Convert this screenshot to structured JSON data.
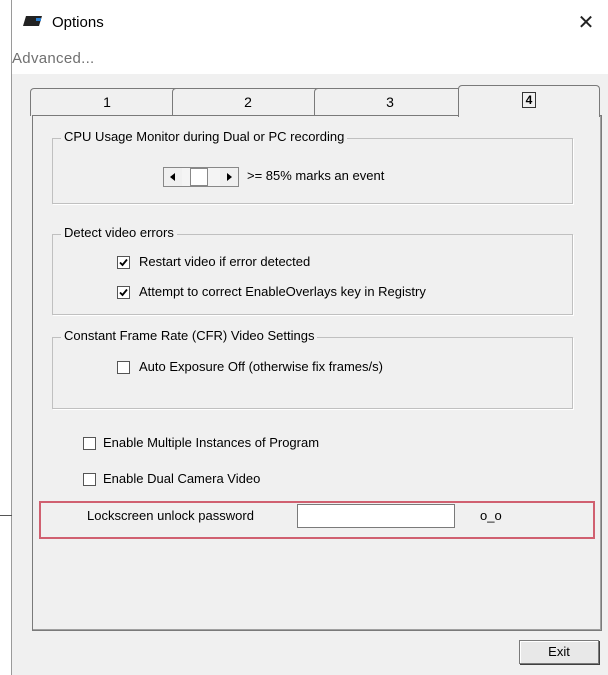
{
  "window": {
    "title": "Options",
    "close_glyph": "✕",
    "app_icon": "camera-icon"
  },
  "menu": {
    "advanced": "Advanced..."
  },
  "tabs": [
    {
      "label": "1",
      "active": false
    },
    {
      "label": "2",
      "active": false
    },
    {
      "label": "3",
      "active": false
    },
    {
      "label": "4",
      "active": true
    }
  ],
  "cpu_group": {
    "title": "CPU Usage Monitor during Dual or PC recording",
    "threshold_text": ">= 85% marks an event"
  },
  "video_errors_group": {
    "title": "Detect video errors",
    "restart_label": "Restart video if error detected",
    "restart_checked": true,
    "overlays_label": "Attempt to correct EnableOverlays key in Registry",
    "overlays_checked": true
  },
  "cfr_group": {
    "title": "Constant Frame Rate (CFR) Video Settings",
    "auto_exposure_label": "Auto Exposure Off (otherwise fix frames/s)",
    "auto_exposure_checked": false
  },
  "options": {
    "multi_instances_label": "Enable Multiple Instances of Program",
    "multi_instances_checked": false,
    "dual_camera_label": "Enable Dual Camera Video",
    "dual_camera_checked": false
  },
  "lockscreen": {
    "label": "Lockscreen unlock password",
    "value": "",
    "suffix": "o_o"
  },
  "buttons": {
    "exit": "Exit"
  },
  "colors": {
    "highlight": "#d06070",
    "panel_bg": "#f0f0f0"
  }
}
